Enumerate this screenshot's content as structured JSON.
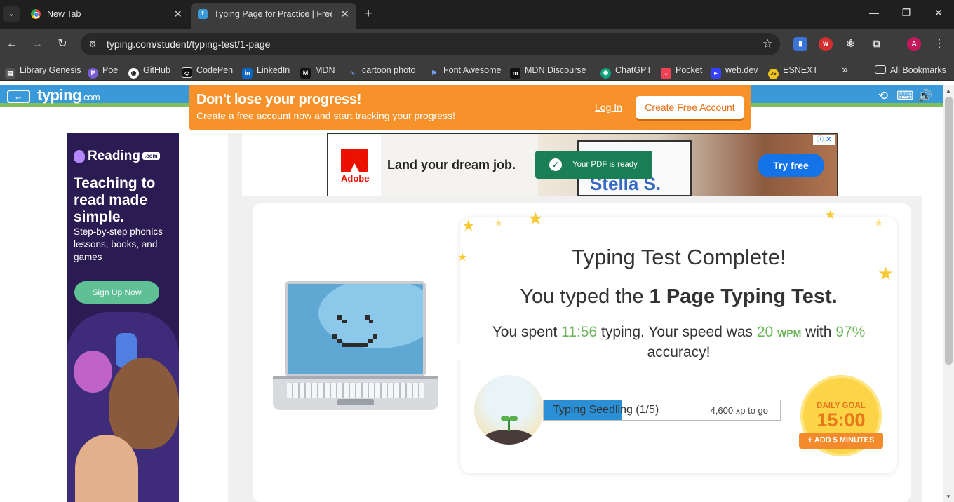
{
  "browser": {
    "tabs": [
      {
        "title": "New Tab",
        "active": false,
        "icon": "chrome-icon"
      },
      {
        "title": "Typing Page for Practice | Free T",
        "active": true,
        "icon": "typing-favicon"
      }
    ],
    "url": "typing.com/student/typing-test/1-page",
    "profile_initial": "A",
    "bookmarks": [
      {
        "label": "Library Genesis",
        "icon": "book-icon"
      },
      {
        "label": "Poe",
        "icon": "poe-icon"
      },
      {
        "label": "GitHub",
        "icon": "github-icon"
      },
      {
        "label": "CodePen",
        "icon": "codepen-icon"
      },
      {
        "label": "LinkedIn",
        "icon": "linkedin-icon"
      },
      {
        "label": "MDN",
        "icon": "mdn-icon"
      },
      {
        "label": "cartoon photo",
        "icon": "image-icon"
      },
      {
        "label": "Font Awesome",
        "icon": "flag-icon"
      },
      {
        "label": "MDN Discourse",
        "icon": "mdn-discourse-icon"
      },
      {
        "label": "ChatGPT",
        "icon": "chatgpt-icon"
      },
      {
        "label": "Pocket",
        "icon": "pocket-icon"
      },
      {
        "label": "web.dev",
        "icon": "webdev-icon"
      },
      {
        "label": "ESNEXT",
        "icon": "js-icon"
      }
    ],
    "all_bookmarks": "All Bookmarks",
    "overflow": "»"
  },
  "site": {
    "logo": "typing",
    "logo_suffix": ".com",
    "back_arrow": "←"
  },
  "promo": {
    "heading": "Don't lose your progress!",
    "subtext": "Create a free account now and start tracking your progress!",
    "login": "Log In",
    "create": "Create Free Account"
  },
  "side_ad": {
    "brand": "Reading",
    "brand_suffix": ".com",
    "headline": "Teaching to read made simple.",
    "body": "Step-by-step phonics lessons, books, and games",
    "cta": "Sign Up Now"
  },
  "top_ad": {
    "brand": "Adobe",
    "tagline": "Land your dream job.",
    "toast": "Your PDF is ready",
    "name_preview": "Stella S.",
    "cta": "Try free"
  },
  "results": {
    "title": "Typing Test Complete!",
    "typed_prefix": "You typed the ",
    "typed_test": "1 Page Typing Test.",
    "spent_prefix": "You spent ",
    "time": "11:56",
    "speed_mid": " typing. Your speed was ",
    "wpm_value": "20",
    "wpm_unit": "WPM",
    "with": " with ",
    "accuracy": "97%",
    "accuracy_suffix": "accuracy!",
    "level_label": "Typing Seedling (1/5)",
    "xp_to_go": "4,600 xp to go",
    "xp_progress_fraction": 0.33,
    "daily_goal_label": "DAILY GOAL",
    "daily_goal_time": "15:00",
    "add_minutes": "+ ADD 5 MINUTES"
  },
  "colors": {
    "header_blue": "#3a9ad9",
    "header_green": "#7fc05d",
    "promo_orange": "#f7922a",
    "stat_green": "#6bb55a",
    "goal_yellow": "#fcd447"
  }
}
